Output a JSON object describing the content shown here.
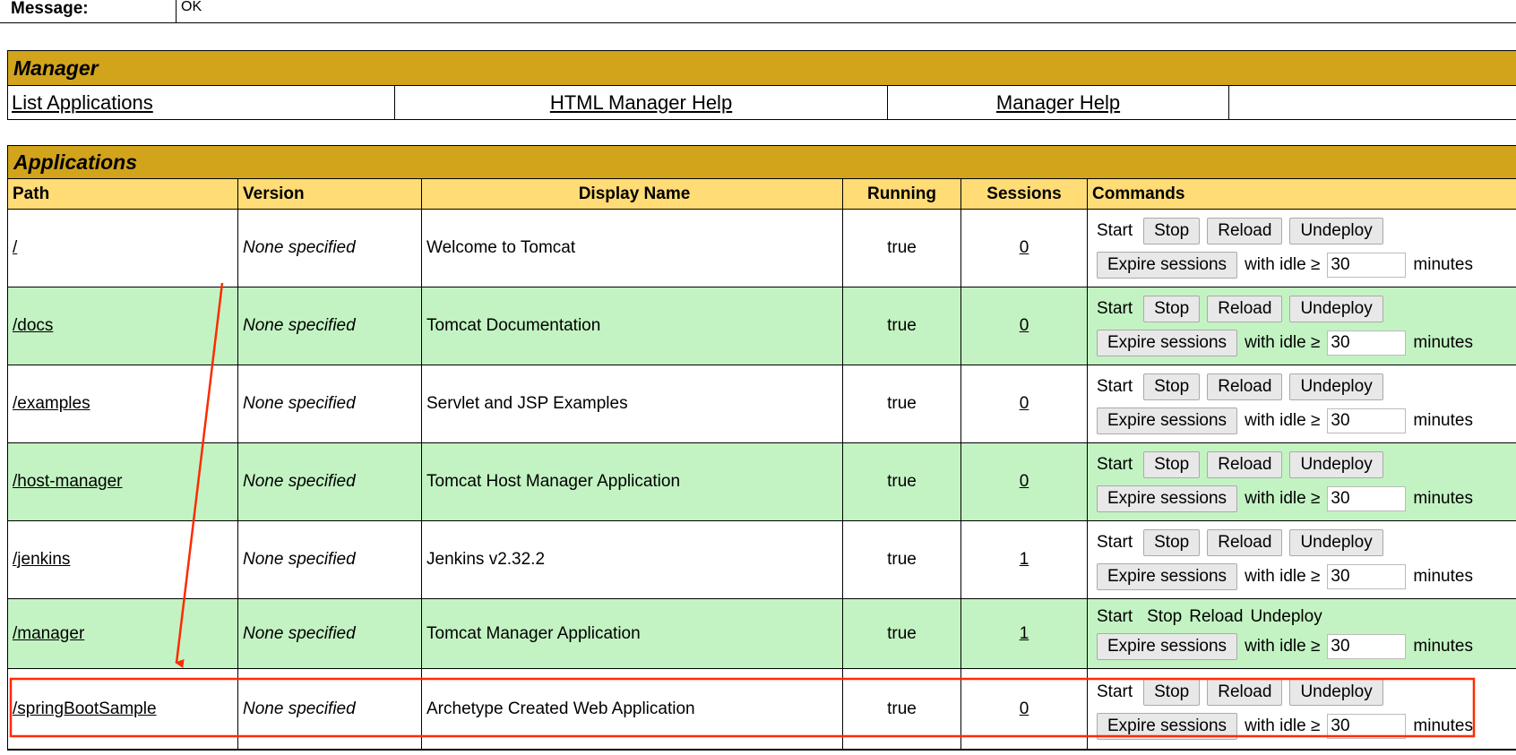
{
  "message": {
    "label": "Message:",
    "value": "OK"
  },
  "manager": {
    "title": "Manager",
    "links": [
      "List Applications",
      "HTML Manager Help",
      "Manager Help",
      ""
    ]
  },
  "applications": {
    "title": "Applications",
    "headers": {
      "path": "Path",
      "version": "Version",
      "display_name": "Display Name",
      "running": "Running",
      "sessions": "Sessions",
      "commands": "Commands"
    },
    "commands": {
      "start": "Start",
      "stop": "Stop",
      "reload": "Reload",
      "undeploy": "Undeploy",
      "expire": "Expire sessions",
      "with_idle": "with idle ≥",
      "minutes": "minutes",
      "idle_value": "30"
    },
    "rows": [
      {
        "path": "/",
        "version": "None specified",
        "display_name": "Welcome to Tomcat",
        "running": "true",
        "sessions": "0"
      },
      {
        "path": "/docs",
        "version": "None specified",
        "display_name": "Tomcat Documentation",
        "running": "true",
        "sessions": "0"
      },
      {
        "path": "/examples",
        "version": "None specified",
        "display_name": "Servlet and JSP Examples",
        "running": "true",
        "sessions": "0"
      },
      {
        "path": "/host-manager",
        "version": "None specified",
        "display_name": "Tomcat Host Manager Application",
        "running": "true",
        "sessions": "0"
      },
      {
        "path": "/jenkins",
        "version": "None specified",
        "display_name": "Jenkins v2.32.2",
        "running": "true",
        "sessions": "1"
      },
      {
        "path": "/manager",
        "version": "None specified",
        "display_name": "Tomcat Manager Application",
        "running": "true",
        "sessions": "1"
      },
      {
        "path": "/springBootSample",
        "version": "None specified",
        "display_name": "Archetype Created Web Application",
        "running": "true",
        "sessions": "0"
      }
    ]
  },
  "colors": {
    "manager_header": "#d2a41c",
    "table_header": "#ffdc75",
    "alt_row": "#c3f3c3",
    "annotation": "#ff2a00"
  }
}
